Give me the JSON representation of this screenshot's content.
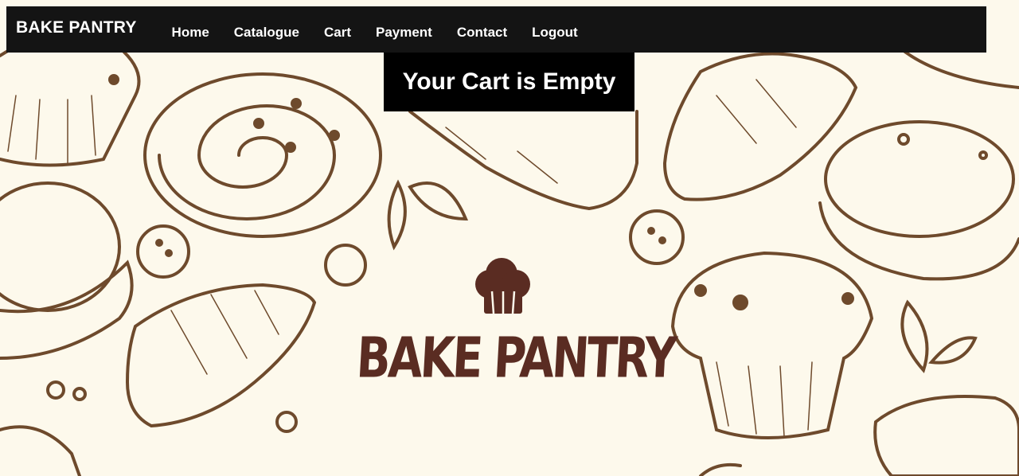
{
  "navbar": {
    "brand": "BAKE PANTRY",
    "links": [
      "Home",
      "Catalogue",
      "Cart",
      "Payment",
      "Contact",
      "Logout"
    ]
  },
  "cart": {
    "message": "Your Cart is Empty"
  },
  "background": {
    "logo_text": "BAKE PANTRY",
    "colors": {
      "page": "#fdf9ec",
      "sketch": "#6e4a2c",
      "logo": "#5a2c22"
    }
  },
  "colors": {
    "navbar": "#141414",
    "message_box": "#000000",
    "text": "#ffffff"
  }
}
